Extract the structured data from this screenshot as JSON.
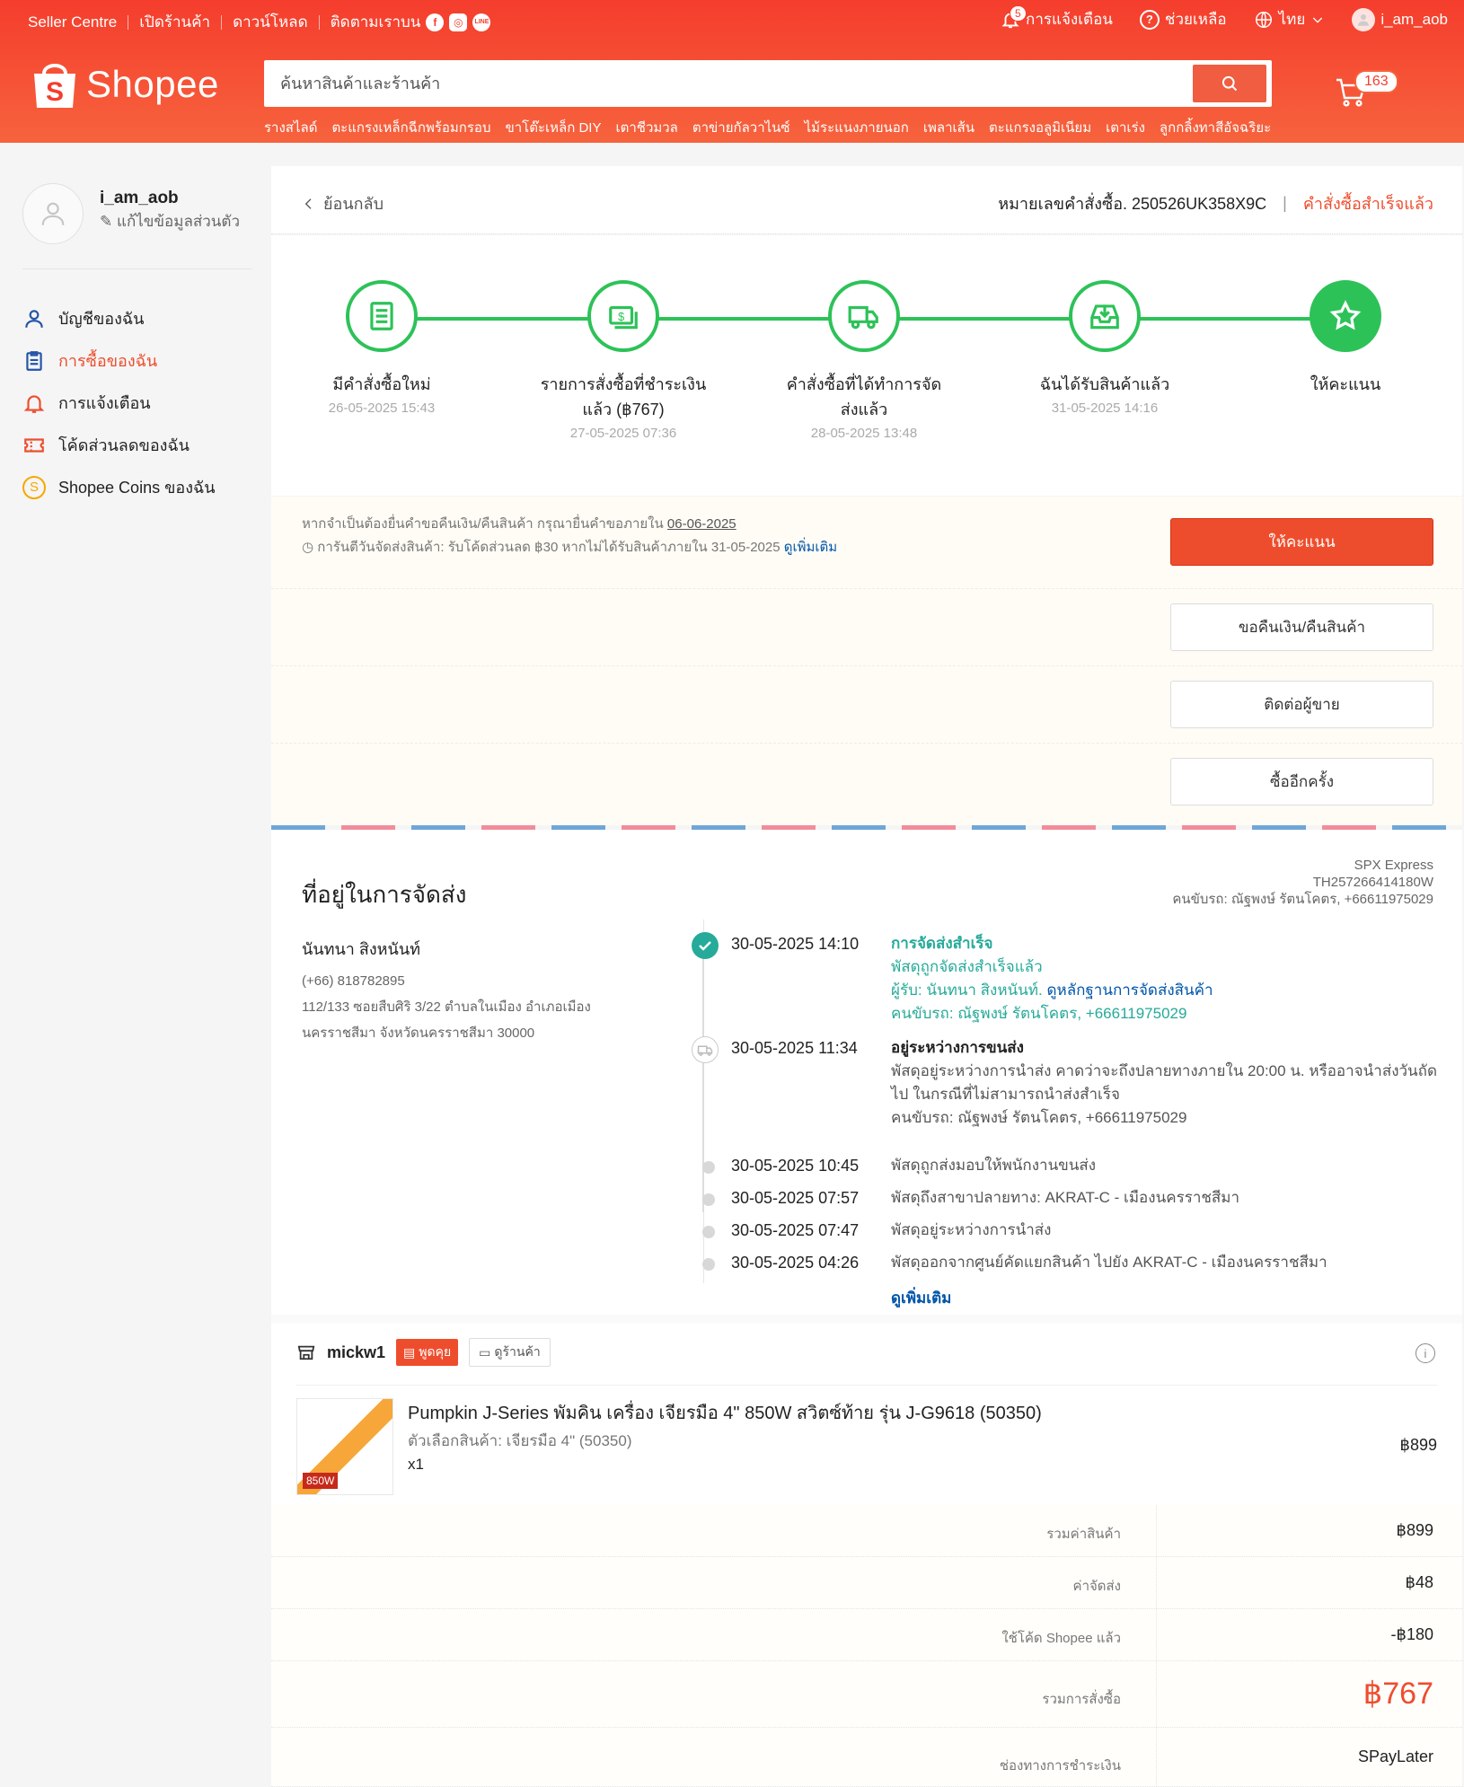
{
  "header": {
    "top_left": [
      "Seller Centre",
      "เปิดร้านค้า",
      "ดาวน์โหลด",
      "ติดตามเราบน"
    ],
    "social": [
      "f",
      "◎",
      "LINE"
    ],
    "notifications_label": "การแจ้งเตือน",
    "notifications_count": "5",
    "help_label": "ช่วยเหลือ",
    "language": "ไทย",
    "username": "i_am_aob",
    "logo_text": "Shopee",
    "search_placeholder": "ค้นหาสินค้าและร้านค้า",
    "hotwords": [
      "รางสไลด์",
      "ตะแกรงเหล็กฉีกพร้อมกรอบ",
      "ขาโต๊ะเหล็ก DIY",
      "เตาชีวมวล",
      "ตาข่ายกัลวาไนซ์",
      "ไม้ระแนงภายนอก",
      "เพลาเส้น",
      "ตะแกรงอลูมิเนียม",
      "เตาเร่ง",
      "ลูกกลิ้งทาสีอัจฉริยะ"
    ],
    "cart_count": "163"
  },
  "sidebar": {
    "username": "i_am_aob",
    "edit_profile": "แก้ไขข้อมูลส่วนตัว",
    "items": [
      {
        "label": "บัญชีของฉัน",
        "icon": "user-icon"
      },
      {
        "label": "การซื้อของฉัน",
        "icon": "clipboard-icon"
      },
      {
        "label": "การแจ้งเตือน",
        "icon": "bell-icon"
      },
      {
        "label": "โค้ดส่วนลดของฉัน",
        "icon": "ticket-icon"
      },
      {
        "label": "Shopee Coins ของฉัน",
        "icon": "coin-icon"
      }
    ],
    "coin_glyph": "S"
  },
  "order": {
    "back_label": "ย้อนกลับ",
    "order_id": "หมายเลขคำสั่งซื้อ. 250526UK358X9C",
    "divider": "|",
    "status": "คำสั่งซื้อสำเร็จแล้ว",
    "steps": [
      {
        "label": "มีคำสั่งซื้อใหม่",
        "date": "26-05-2025 15:43"
      },
      {
        "label": "รายการสั่งซื้อที่ชำระเงินแล้ว (฿767)",
        "date": "27-05-2025 07:36"
      },
      {
        "label": "คำสั่งซื้อที่ได้ทำการจัดส่งแล้ว",
        "date": "28-05-2025 13:48"
      },
      {
        "label": "ฉันได้รับสินค้าแล้ว",
        "date": "31-05-2025 14:16"
      },
      {
        "label": "ให้คะแนน",
        "date": ""
      }
    ],
    "notice_line1": "หากจำเป็นต้องยื่นคำขอคืนเงิน/คืนสินค้า กรุณายื่นคำขอภายใน",
    "notice_date": "06-06-2025",
    "notice_line2": "การันตีวันจัดส่งสินค้า: รับโค้ดส่วนลด ฿30 หากไม่ได้รับสินค้าภายใน 31-05-2025",
    "notice_more": "ดูเพิ่มเติม",
    "buttons": {
      "rate": "ให้คะแนน",
      "refund": "ขอคืนเงิน/คืนสินค้า",
      "contact": "ติดต่อผู้ขาย",
      "rebuy": "ซื้ออีกครั้ง"
    }
  },
  "shipping": {
    "title": "ที่อยู่ในการจัดส่ง",
    "carrier": "SPX Express",
    "tracking": "TH257266414180W",
    "driver": "คนขับรถ: ณัฐพงษ์ รัตนโคตร, +66611975029",
    "recipient_name": "นันทนา สิงหนันท์",
    "phone": "(+66) 818782895",
    "address": "112/133 ซอยสืบศิริ 3/22 ตำบลในเมือง อำเภอเมืองนครราชสีมา จังหวัดนครราชสีมา 30000",
    "events": [
      {
        "time": "30-05-2025 14:10",
        "title": "การจัดส่งสำเร็จ",
        "l2": "พัสดุถูกจัดส่งสำเร็จแล้ว",
        "l3": "ผู้รับ: นันทนา สิงหนันท์.",
        "l3_link": "ดูหลักฐานการจัดส่งสินค้า",
        "l4": "คนขับรถ: ณัฐพงษ์ รัตนโคตร, +66611975029"
      },
      {
        "time": "30-05-2025 11:34",
        "title": "อยู่ระหว่างการขนส่ง",
        "l2": "พัสดุอยู่ระหว่างการนำส่ง คาดว่าจะถึงปลายทางภายใน 20:00 น. หรืออาจนำส่งวันถัดไป ในกรณีที่ไม่สามารถนำส่งสำเร็จ",
        "l4": "คนขับรถ: ณัฐพงษ์ รัตนโคตร, +66611975029"
      },
      {
        "time": "30-05-2025 10:45",
        "text": "พัสดุถูกส่งมอบให้พนักงานขนส่ง"
      },
      {
        "time": "30-05-2025 07:57",
        "text": "พัสดุถึงสาขาปลายทาง: AKRAT-C - เมืองนครราชสีมา"
      },
      {
        "time": "30-05-2025 07:47",
        "text": "พัสดุอยู่ระหว่างการนำส่ง"
      },
      {
        "time": "30-05-2025 04:26",
        "text": "พัสดุออกจากศูนย์คัดแยกสินค้า ไปยัง AKRAT-C - เมืองนครราชสีมา"
      }
    ],
    "see_more": "ดูเพิ่มเติม"
  },
  "shop": {
    "name": "mickw1",
    "chat": "พูดคุย",
    "view_shop": "ดูร้านค้า",
    "info_glyph": "i",
    "thumb_tag": "850W",
    "product_name": "Pumpkin J-Series พัมคิน เครื่อง เจียรมือ 4\" 850W สวิตซ์ท้าย รุ่น J-G9618 (50350)",
    "variation": "ตัวเลือกสินค้า: เจียรมือ 4\" (50350)",
    "qty": "x1",
    "price": "฿899"
  },
  "summary": [
    {
      "label": "รวมค่าสินค้า",
      "value": "฿899"
    },
    {
      "label": "ค่าจัดส่ง",
      "value": "฿48"
    },
    {
      "label": "ใช้โค้ด Shopee แล้ว",
      "value": "-฿180"
    },
    {
      "label": "รวมการสั่งซื้อ",
      "value": "฿767"
    },
    {
      "label": "ช่องทางการชำระเงิน",
      "value": "SPayLater"
    }
  ]
}
